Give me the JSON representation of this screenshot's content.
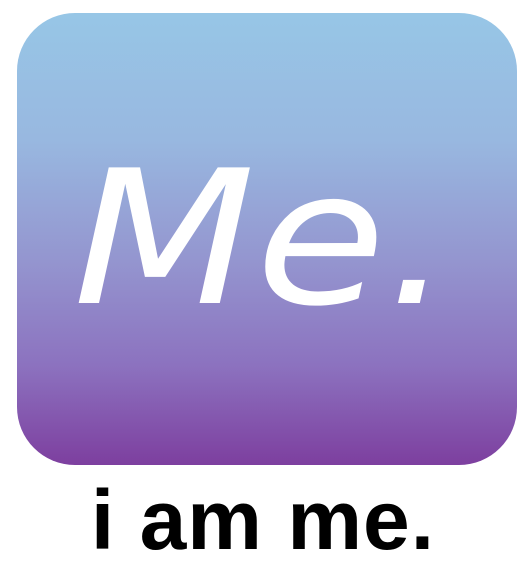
{
  "logo": {
    "icon_text": "Me.",
    "gradient_colors": [
      "#97c6e6",
      "#9495cf",
      "#7d3f9f"
    ],
    "text_color": "#ffffff"
  },
  "tagline": "i am me."
}
